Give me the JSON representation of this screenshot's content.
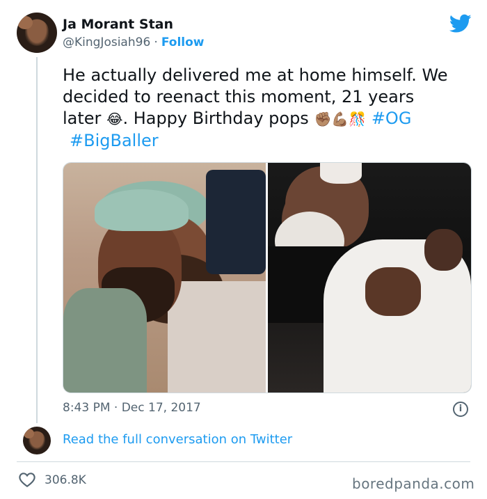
{
  "tweet": {
    "author_name": "Ja Morant Stan",
    "handle": "@KingJosiah96",
    "separator": "·",
    "follow_label": "Follow",
    "text_line1": "He actually delivered me at home himself. We",
    "text_line2": "decided to reenact this moment, 21 years",
    "text_line3_a": "later",
    "emoji_laugh": "😂",
    "text_line3_b": ". Happy Birthday pops",
    "emoji_fist": "✊🏽",
    "emoji_muscle": "💪🏽",
    "emoji_confetti": "🎊",
    "hashtag_og": "#OG",
    "hashtag_bigballer": "#BigBaller",
    "timestamp": "8:43 PM · Dec 17, 2017",
    "conversation_link": "Read the full conversation on Twitter",
    "like_count": "306.8K",
    "info_glyph": "i"
  },
  "watermark": "boredpanda.com",
  "icons": {
    "twitter": "twitter-bird-icon",
    "info": "info-icon",
    "like": "heart-icon"
  },
  "colors": {
    "accent": "#1d9bf0",
    "secondary_text": "#536471"
  }
}
